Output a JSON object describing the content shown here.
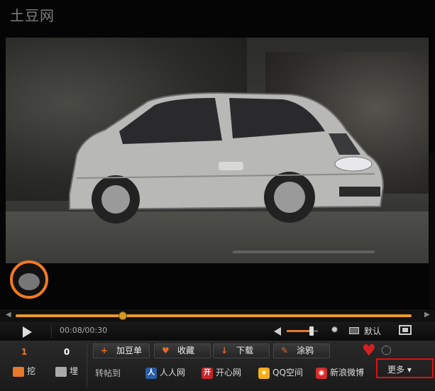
{
  "player": {
    "watermark": "土豆网",
    "time_display": "00:08/00:30",
    "quality_label": "默认",
    "progress": 0.27,
    "buffered": 1.0,
    "volume": 0.8
  },
  "votes": {
    "up_count": "1",
    "up_label": "挖",
    "down_count": "0",
    "down_label": "埋"
  },
  "actions": [
    {
      "icon": "+",
      "label": "加豆单"
    },
    {
      "icon": "♥",
      "label": "收藏"
    },
    {
      "icon": "↓",
      "label": "下载"
    },
    {
      "icon": "✎",
      "label": "涂鸦"
    }
  ],
  "share": {
    "label": "转帖到",
    "targets": [
      {
        "label": "人人网",
        "icon": "renren-icon",
        "color": "#2b5ea8"
      },
      {
        "label": "开心网",
        "icon": "kaixin-icon",
        "color": "#c8252a"
      },
      {
        "label": "QQ空间",
        "icon": "qzone-icon",
        "color": "#f2b01c"
      },
      {
        "label": "新浪微博",
        "icon": "weibo-icon",
        "color": "#d52b2b"
      }
    ]
  },
  "more": {
    "label": "更多"
  },
  "colors": {
    "accent": "#e8782a",
    "progress": "#e89a2c",
    "highlight_box": "#e01010"
  }
}
